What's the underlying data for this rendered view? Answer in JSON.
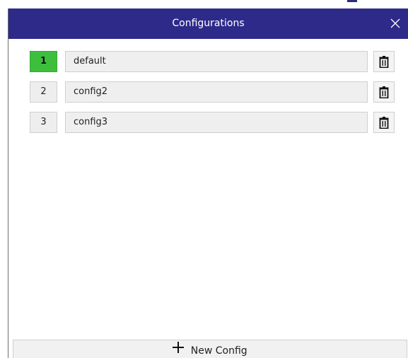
{
  "window": {
    "title": "Configurations",
    "close_icon": "close-icon"
  },
  "configs": [
    {
      "number": "1",
      "name": "default",
      "active": true,
      "delete_icon": "trash-icon"
    },
    {
      "number": "2",
      "name": "config2",
      "active": false,
      "delete_icon": "trash-icon"
    },
    {
      "number": "3",
      "name": "config3",
      "active": false,
      "delete_icon": "trash-icon"
    }
  ],
  "footer": {
    "new_config_label": "New Config",
    "new_config_icon": "plus-icon"
  },
  "colors": {
    "titlebar": "#2e2a8a",
    "active_number": "#3dbf3d",
    "field_background": "#efefef"
  }
}
